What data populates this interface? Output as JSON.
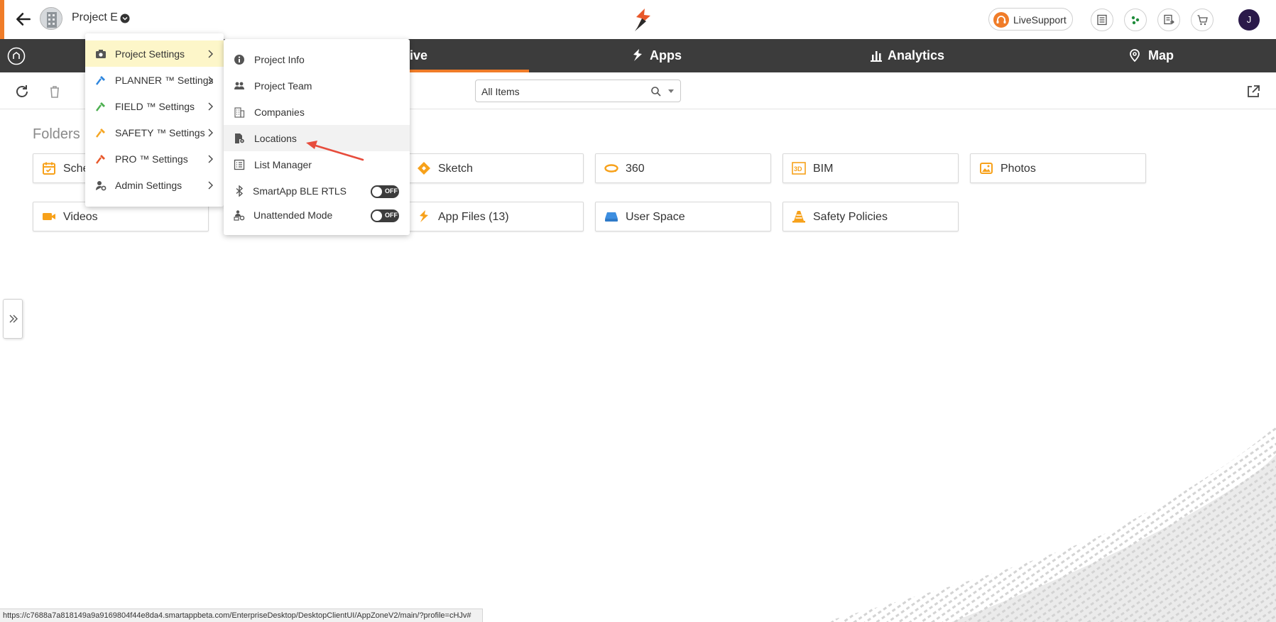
{
  "header": {
    "project_name": "Project E",
    "livesupport_label": "LiveSupport",
    "user_initial": "J",
    "accent_color": "#f07c28"
  },
  "nav": {
    "tabs": [
      {
        "label": "rive",
        "icon": "drive-icon"
      },
      {
        "label": "Apps",
        "icon": "apps-icon"
      },
      {
        "label": "Analytics",
        "icon": "analytics-icon"
      },
      {
        "label": "Map",
        "icon": "map-pin-icon"
      }
    ]
  },
  "toolbar": {
    "filter_value": "All Items"
  },
  "folders": {
    "title": "Folders",
    "items": [
      {
        "label": "Sche",
        "icon": "calendar-icon"
      },
      {
        "label": "Sketch",
        "icon": "sketch-icon"
      },
      {
        "label": "360",
        "icon": "360-icon"
      },
      {
        "label": "BIM",
        "icon": "bim-icon"
      },
      {
        "label": "Photos",
        "icon": "photos-icon"
      },
      {
        "label": "Videos",
        "icon": "video-icon"
      },
      {
        "label": "App Files (13)",
        "icon": "app-files-icon"
      },
      {
        "label": "User Space",
        "icon": "user-space-icon"
      },
      {
        "label": "Safety Policies",
        "icon": "cone-icon"
      }
    ]
  },
  "settings_menu": {
    "items": [
      {
        "label": "Project Settings",
        "icon": "camera-icon",
        "active": true
      },
      {
        "label": "PLANNER ™ Settings",
        "icon": "hammer-icon"
      },
      {
        "label": "FIELD ™ Settings",
        "icon": "hammer-icon"
      },
      {
        "label": "SAFETY ™ Settings",
        "icon": "hammer-icon"
      },
      {
        "label": "PRO ™ Settings",
        "icon": "hammer-icon"
      },
      {
        "label": "Admin Settings",
        "icon": "admin-gear-icon"
      }
    ]
  },
  "project_settings_submenu": {
    "items": [
      {
        "label": "Project Info",
        "icon": "info-icon"
      },
      {
        "label": "Project Team",
        "icon": "team-icon"
      },
      {
        "label": "Companies",
        "icon": "building-icon"
      },
      {
        "label": "Locations",
        "icon": "location-doc-icon",
        "hover": true
      },
      {
        "label": "List Manager",
        "icon": "list-icon"
      },
      {
        "label": "SmartApp BLE RTLS",
        "icon": "bluetooth-icon",
        "toggle": "OFF"
      },
      {
        "label": "Unattended Mode",
        "icon": "unattended-icon",
        "toggle": "OFF"
      }
    ]
  },
  "status_url": "https://c7688a7a818149a9a9169804f44e8da4.smartappbeta.com/EnterpriseDesktop/DesktopClientUI/AppZoneV2/main/?profile=cHJv#"
}
